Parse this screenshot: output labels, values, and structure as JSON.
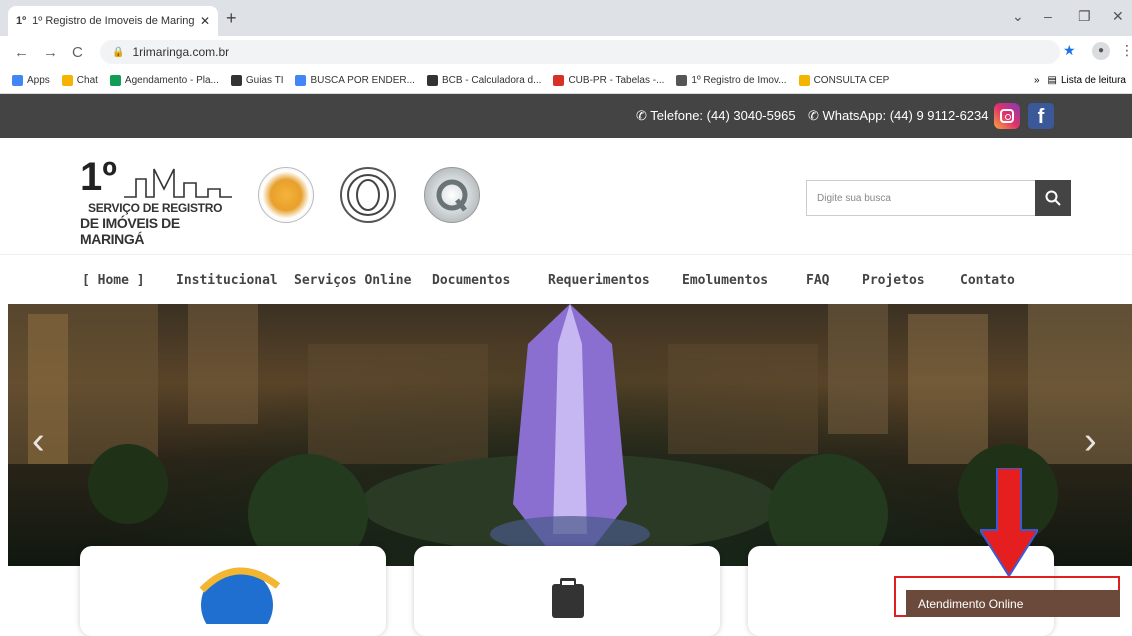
{
  "browser": {
    "tab_title": "1º Registro de Imoveis de Maring",
    "tab_favicon": "1º",
    "new_tab": "+",
    "url": "1rimaringa.com.br",
    "bookmarks": [
      {
        "label": "Apps",
        "color": "#4285f4"
      },
      {
        "label": "Chat",
        "color": "#f4b400"
      },
      {
        "label": "Agendamento - Pla...",
        "color": "#0f9d58"
      },
      {
        "label": "Guias TI",
        "color": "#333333"
      },
      {
        "label": "BUSCA POR ENDER...",
        "color": "#4285f4"
      },
      {
        "label": "BCB - Calculadora d...",
        "color": "#333333"
      },
      {
        "label": "CUB-PR - Tabelas -...",
        "color": "#d93025"
      },
      {
        "label": "1º Registro de Imov...",
        "color": "#555555"
      },
      {
        "label": "CONSULTA CEP",
        "color": "#f4b400"
      }
    ],
    "reading_list": "Lista de leitura"
  },
  "topbar": {
    "phone": "Telefone: (44) 3040-5965",
    "whatsapp": "WhatsApp: (44) 9 9112-6234"
  },
  "logo": {
    "number": "1º",
    "line1": "SERVIÇO DE REGISTRO",
    "line2": "DE IMÓVEIS DE MARINGÁ"
  },
  "search": {
    "placeholder": "Digite sua busca"
  },
  "menu": [
    "[ Home ]",
    "Institucional",
    "Serviços Online",
    "Documentos",
    "Requerimentos",
    "Emolumentos",
    "FAQ",
    "Projetos",
    "Contato"
  ],
  "chat": {
    "label": "Atendimento Online"
  }
}
